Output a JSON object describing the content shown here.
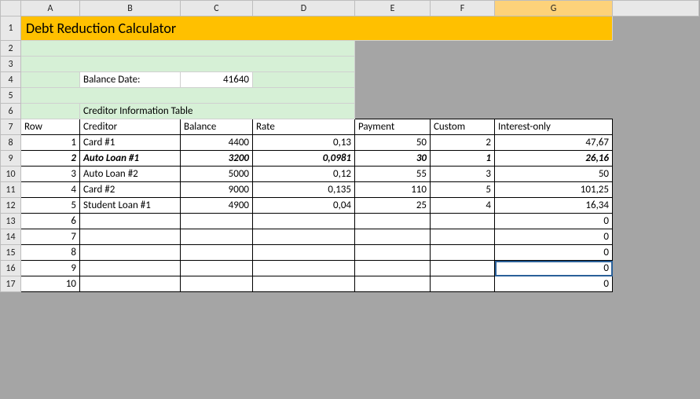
{
  "columns": [
    "A",
    "B",
    "C",
    "D",
    "E",
    "F",
    "G"
  ],
  "rowNumbers": [
    1,
    2,
    3,
    4,
    5,
    6,
    7,
    8,
    9,
    10,
    11,
    12,
    13,
    14,
    15,
    16,
    17
  ],
  "title": "Debt Reduction Calculator",
  "balanceDate": {
    "label": "Balance Date:",
    "value": "41640"
  },
  "tableCaption": "Creditor Information Table",
  "headers": {
    "row": "Row",
    "creditor": "Creditor",
    "balance": "Balance",
    "rate": "Rate",
    "payment": "Payment",
    "custom": "Custom",
    "interestOnly": "Interest-only"
  },
  "rows": [
    {
      "n": "1",
      "creditor": "Card #1",
      "balance": "4400",
      "rate": "0,13",
      "payment": "50",
      "custom": "2",
      "interest": "47,67",
      "bold": false
    },
    {
      "n": "2",
      "creditor": "Auto Loan #1",
      "balance": "3200",
      "rate": "0,0981",
      "payment": "30",
      "custom": "1",
      "interest": "26,16",
      "bold": true
    },
    {
      "n": "3",
      "creditor": "Auto Loan #2",
      "balance": "5000",
      "rate": "0,12",
      "payment": "55",
      "custom": "3",
      "interest": "50",
      "bold": false
    },
    {
      "n": "4",
      "creditor": "Card #2",
      "balance": "9000",
      "rate": "0,135",
      "payment": "110",
      "custom": "5",
      "interest": "101,25",
      "bold": false
    },
    {
      "n": "5",
      "creditor": "Student Loan #1",
      "balance": "4900",
      "rate": "0,04",
      "payment": "25",
      "custom": "4",
      "interest": "16,34",
      "bold": false
    },
    {
      "n": "6",
      "creditor": "",
      "balance": "",
      "rate": "",
      "payment": "",
      "custom": "",
      "interest": "0",
      "bold": false
    },
    {
      "n": "7",
      "creditor": "",
      "balance": "",
      "rate": "",
      "payment": "",
      "custom": "",
      "interest": "0",
      "bold": false
    },
    {
      "n": "8",
      "creditor": "",
      "balance": "",
      "rate": "",
      "payment": "",
      "custom": "",
      "interest": "0",
      "bold": false
    },
    {
      "n": "9",
      "creditor": "",
      "balance": "",
      "rate": "",
      "payment": "",
      "custom": "",
      "interest": "0",
      "bold": false,
      "active": true
    },
    {
      "n": "10",
      "creditor": "",
      "balance": "",
      "rate": "",
      "payment": "",
      "custom": "",
      "interest": "0",
      "bold": false
    }
  ],
  "activeColumn": "G"
}
